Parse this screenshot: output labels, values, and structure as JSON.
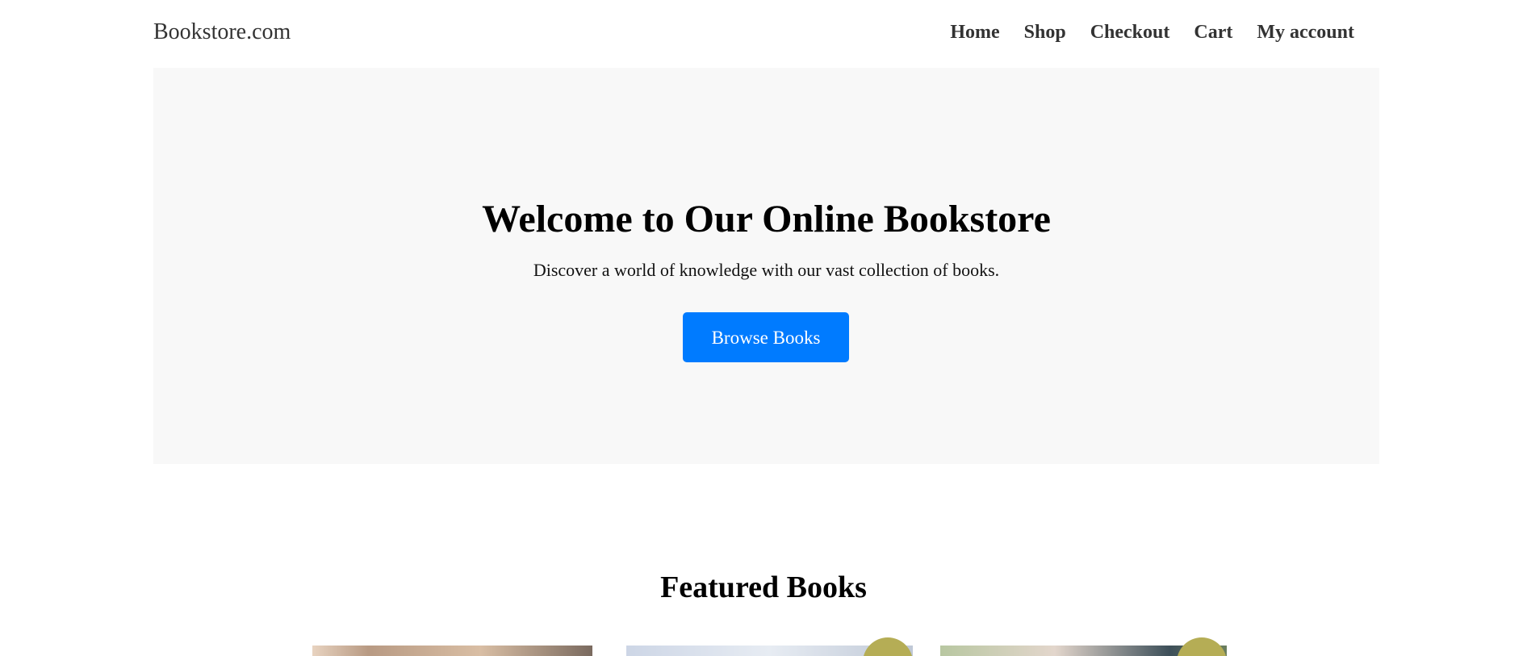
{
  "header": {
    "brand": "Bookstore.com",
    "nav": [
      "Home",
      "Shop",
      "Checkout",
      "Cart",
      "My account"
    ]
  },
  "hero": {
    "title": "Welcome to Our Online Bookstore",
    "subtitle": "Discover a world of knowledge with our vast collection of books.",
    "cta_label": "Browse Books"
  },
  "featured": {
    "title": "Featured Books"
  },
  "colors": {
    "accent": "#007bff",
    "hero_bg": "#f8f8f8",
    "badge": "#b5ad55"
  }
}
